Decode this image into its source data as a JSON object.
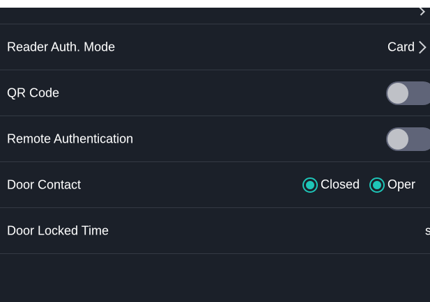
{
  "settings": {
    "reader_auth_mode": {
      "label": "Reader Auth. Mode",
      "value": "Card"
    },
    "qr_code": {
      "label": "QR Code",
      "enabled": false
    },
    "remote_authentication": {
      "label": "Remote Authentication",
      "enabled": false
    },
    "door_contact": {
      "label": "Door Contact",
      "options": [
        "Closed",
        "Oper"
      ]
    },
    "door_locked_time": {
      "label": "Door Locked Time",
      "value": "s"
    }
  },
  "colors": {
    "background": "#1b2029",
    "divider": "#343a44",
    "toggle_track": "#5f6478",
    "toggle_knob": "#bfc1c7",
    "radio_accent": "#1ec6b8"
  },
  "icons": {
    "row_chevron": "chevron-right-icon",
    "radio": "radio-selected-icon"
  }
}
